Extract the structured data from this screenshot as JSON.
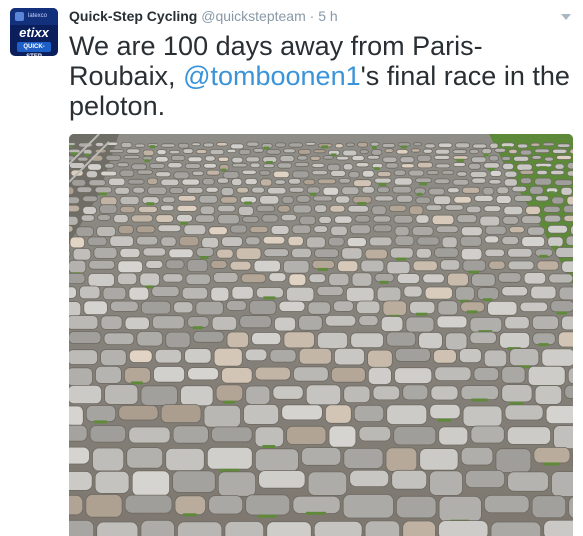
{
  "tweet": {
    "display_name": "Quick-Step Cycling",
    "handle": "@quickstepteam",
    "separator": "·",
    "timestamp": "5 h",
    "text_before": "We are 100 days away from Paris-Roubaix, ",
    "mention": "@tomboonen1",
    "text_after": "'s final race in the peloton."
  },
  "avatar": {
    "brand_text": "etixx",
    "team_text": "QUICK-STEP",
    "sponsor_text": "latexco"
  },
  "media": {
    "subject": "cobblestone road photo"
  },
  "colors": {
    "link": "#3b94d9",
    "muted": "#8899a6",
    "text": "#292f33"
  }
}
